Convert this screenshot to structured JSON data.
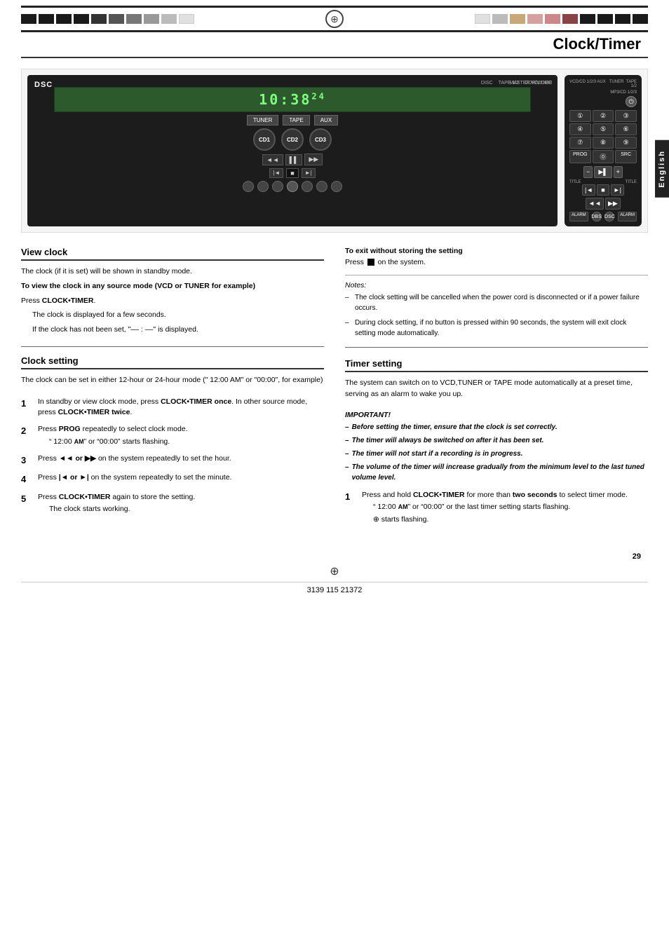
{
  "page": {
    "title": "Clock/Timer",
    "page_number": "29",
    "doc_number": "3139 115 21372",
    "language_tab": "English"
  },
  "top_bar": {
    "left_blocks": [
      "black",
      "black",
      "black",
      "black",
      "black",
      "black",
      "black",
      "gray",
      "gray",
      "light"
    ],
    "right_blocks": [
      "black",
      "black",
      "black",
      "pink",
      "tan",
      "gray",
      "light",
      "white"
    ]
  },
  "device": {
    "dsc_label": "DSC",
    "display_text": "10:38",
    "display_am_pm": "24",
    "source_labels": [
      "DISC",
      "TAPE 1/2",
      "CDR/VIDEO"
    ],
    "tuner_label": "TUNER",
    "tape_label": "TAPE",
    "aux_label": "AUX",
    "cd_labels": [
      "CD1",
      "CD2",
      "CD3"
    ],
    "master_volume_label": "MASTER VOLUME"
  },
  "sections": {
    "view_clock": {
      "header": "View clock",
      "body_intro": "The clock (if it is set) will be shown in standby mode.",
      "sub_header": "To view the clock in any source mode (VCD or TUNER for example)",
      "press_instruction": "Press CLOCK•TIMER.",
      "clock_display_note": "The clock is displayed for a few seconds.",
      "not_set_note": "If the clock has not been set, \"–– : ––\" is displayed."
    },
    "clock_setting": {
      "header": "Clock setting",
      "intro": "The clock can be set in either 12-hour or 24-hour mode (\" 12:00  AM\" or \"00:00\", for example)",
      "steps": [
        {
          "number": "1",
          "text_before": "In standby or view clock mode, press",
          "key1": "CLOCK•TIMER once",
          "text_mid": ". In other source mode, press",
          "key2": "CLOCK•TIMER twice",
          "text_after": "."
        },
        {
          "number": "2",
          "text_before": "Press",
          "key": "PROG",
          "text_after": "repeatedly to select clock mode.",
          "note": "\" 12:00  AM\" or \"00:00\" starts flashing."
        },
        {
          "number": "3",
          "text_before": "Press",
          "key": "◄◄ or ►►",
          "text_after": "on the system repeatedly to set the hour."
        },
        {
          "number": "4",
          "text_before": "Press",
          "key": "|◄ or ►|",
          "text_after": "on the system repeatedly to set the minute."
        },
        {
          "number": "5",
          "text_before": "Press",
          "key": "CLOCK•TIMER",
          "text_after": "again to store the setting.",
          "note": "The clock starts working."
        }
      ]
    },
    "exit_without_storing": {
      "header": "To exit without storing the setting",
      "instruction_before": "Press",
      "stop_icon": "■",
      "instruction_after": "on the system."
    },
    "notes": {
      "title": "Notes:",
      "items": [
        "The clock setting will be cancelled when the power cord is disconnected or if a power failure occurs.",
        "During clock setting, if no button is pressed within 90 seconds, the system will exit clock setting mode automatically."
      ]
    },
    "timer_setting": {
      "header": "Timer setting",
      "intro": "The system can switch on to VCD,TUNER or TAPE mode automatically at a preset time, serving as an alarm to wake you up.",
      "important_title": "IMPORTANT!",
      "important_items": [
        "Before setting the timer, ensure that the clock is set correctly.",
        "The timer will always be switched on after it has been set.",
        "The timer will not start if a recording is in progress.",
        "The volume of the timer will increase gradually from the minimum level to the last tuned volume level."
      ],
      "steps": [
        {
          "number": "1",
          "text": "Press and hold CLOCK•TIMER for more than two seconds to select timer mode.",
          "note1": "\" 12:00  AM\" or \"00:00\" or the last timer setting starts flashing.",
          "note2": "⊕ starts flashing."
        }
      ]
    }
  }
}
